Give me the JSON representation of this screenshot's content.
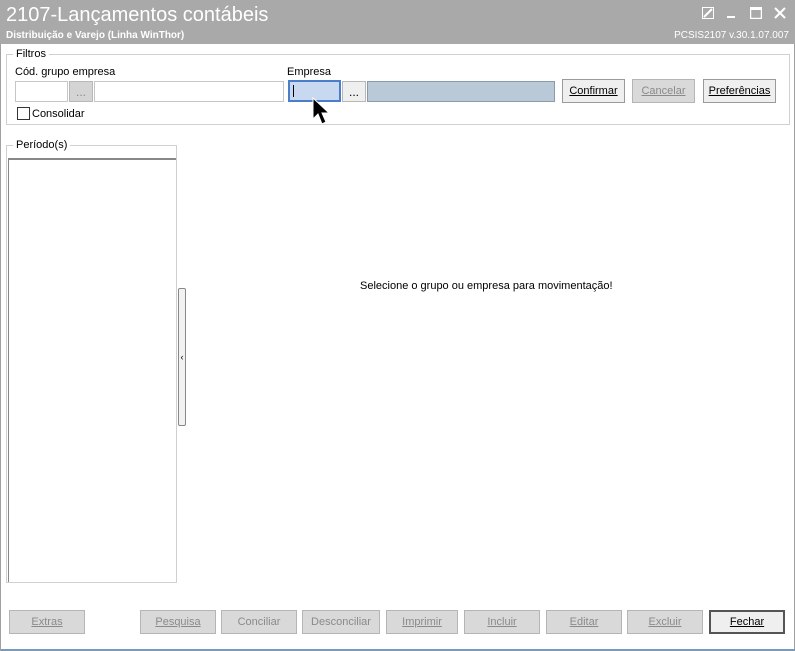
{
  "window": {
    "title": "2107-Lançamentos contábeis",
    "subtitle": "Distribuição e Varejo (Linha WinThor)",
    "version": "PCSIS2107  v.30.1.07.007",
    "controls": [
      "restore-icon",
      "minimize-icon",
      "maximize-icon",
      "close-icon"
    ]
  },
  "filters": {
    "legend": "Filtros",
    "group_label": "Cód. grupo empresa",
    "group_value": "",
    "group_desc": "",
    "empresa_label": "Empresa",
    "empresa_value": "",
    "empresa_desc": "",
    "ellipsis": "...",
    "consolidar_label": "Consolidar",
    "confirm_label": "Confirmar",
    "cancel_label": "Cancelar",
    "prefs_label": "Preferências"
  },
  "periods": {
    "legend": "Período(s)",
    "items": []
  },
  "splitter_glyph": "‹",
  "message": "Selecione o grupo ou empresa para movimentação!",
  "footer": {
    "extras": "Extras",
    "pesquisa": "Pesquisa",
    "conciliar": "Conciliar",
    "desconciliar": "Desconciliar",
    "imprimir": "Imprimir",
    "incluir": "Incluir",
    "editar": "Editar",
    "excluir": "Excluir",
    "fechar": "Fechar"
  }
}
